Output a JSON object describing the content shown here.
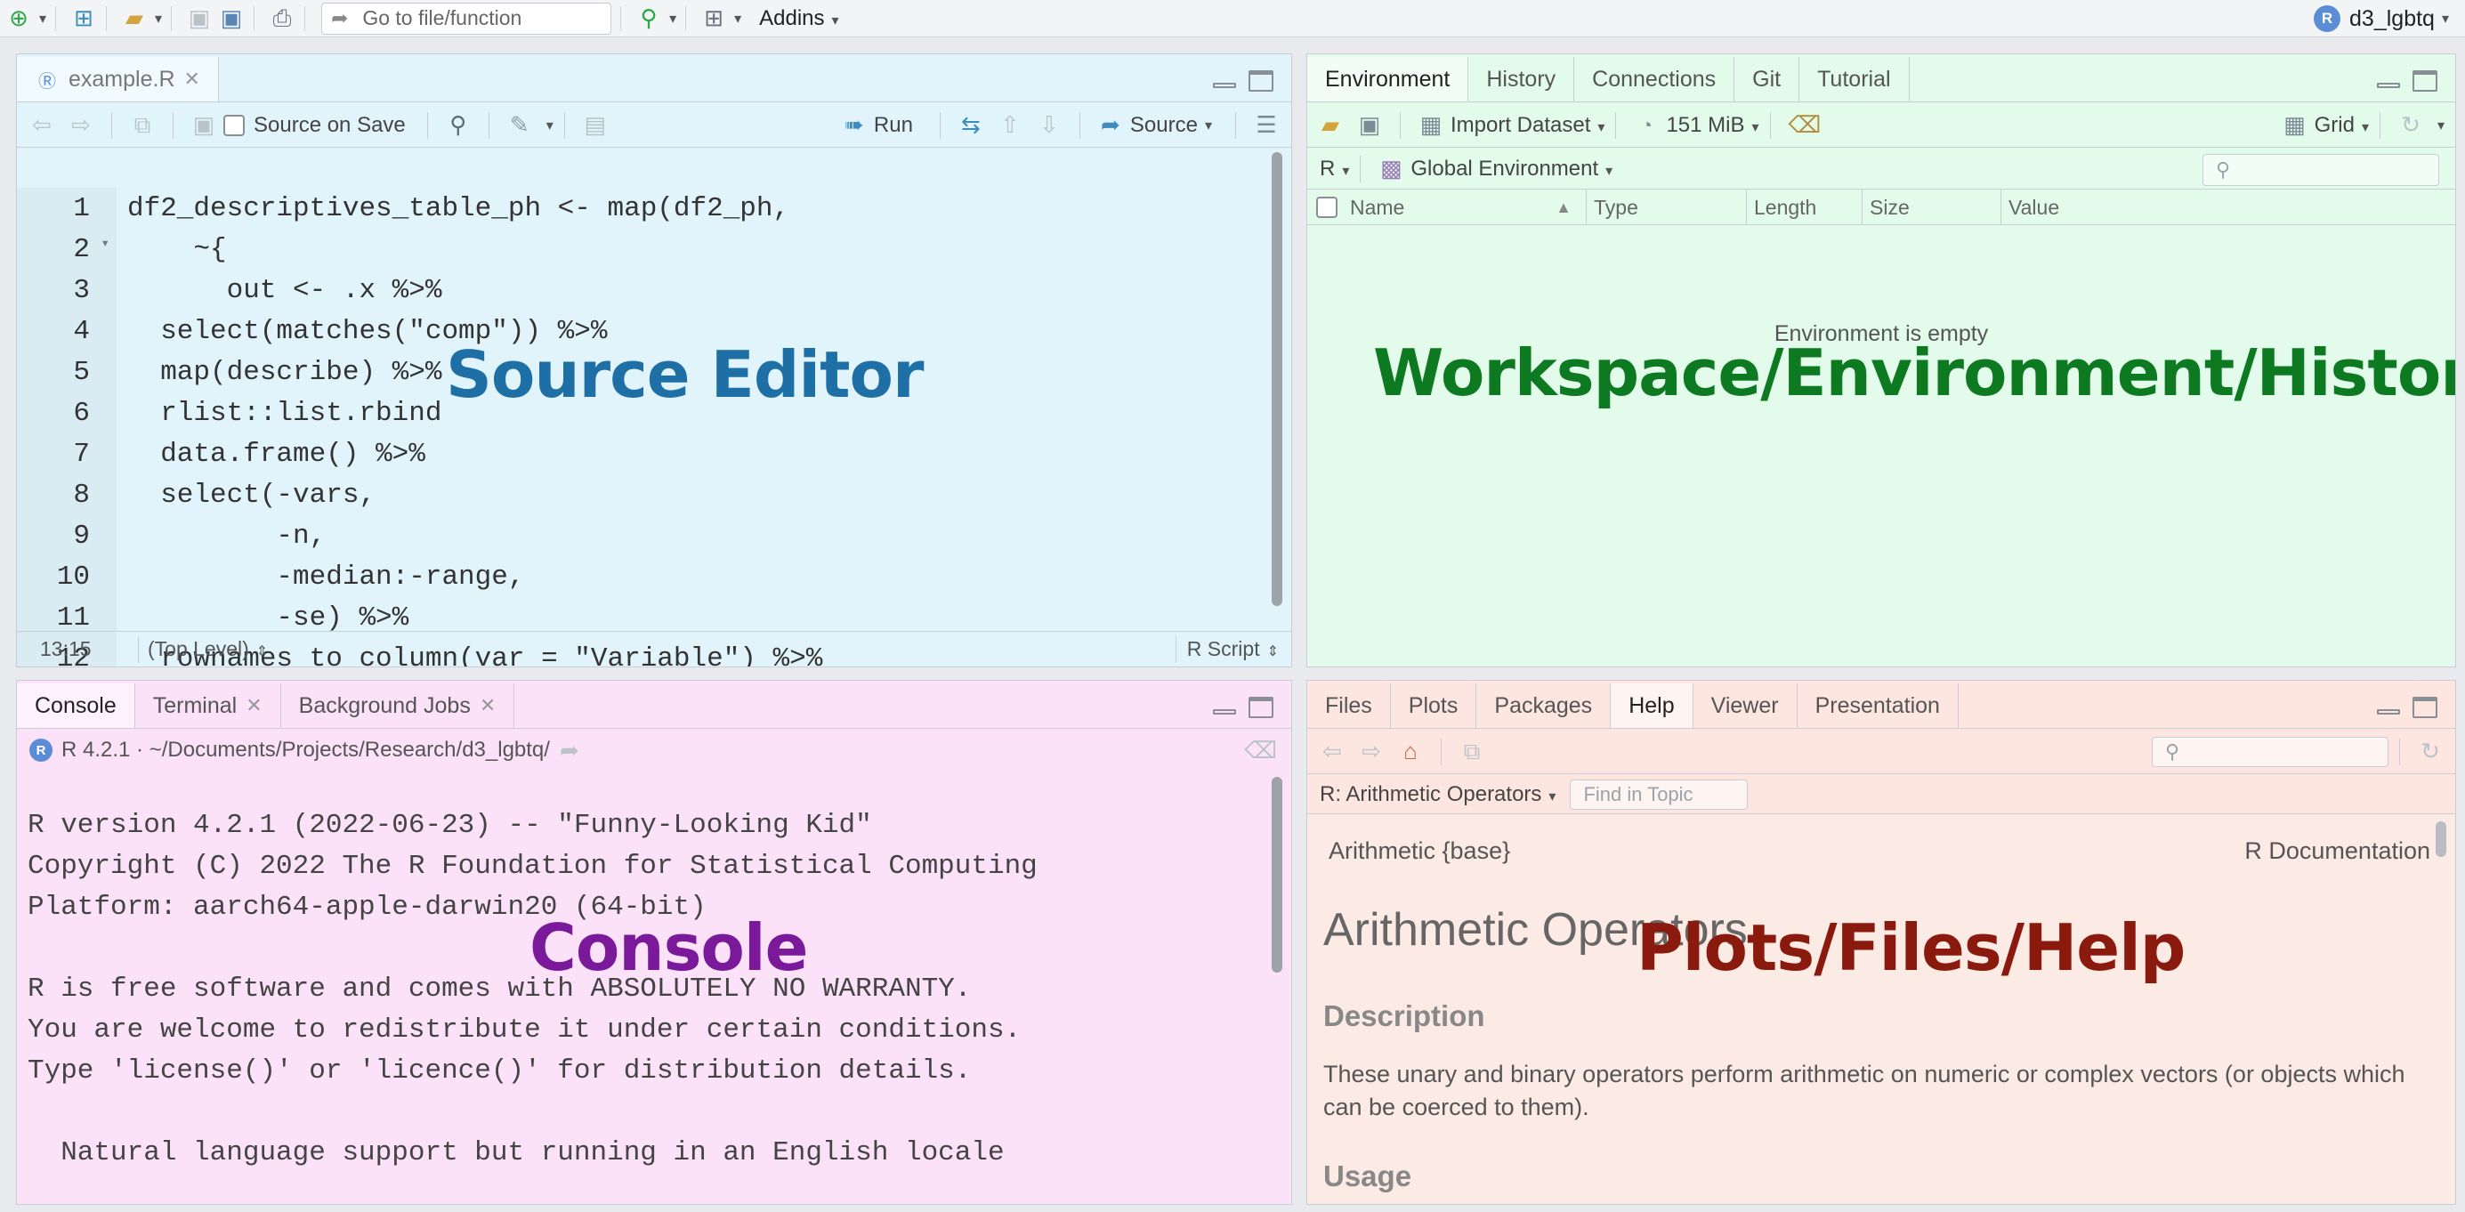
{
  "toolbar": {
    "goto_placeholder": "Go to file/function",
    "addins_label": "Addins",
    "project_name": "d3_lgbtq"
  },
  "source": {
    "file_tab": "example.R",
    "source_on_save": "Source on Save",
    "run_label": "Run",
    "source_label": "Source",
    "lines": [
      {
        "n": "1",
        "text": "df2_descriptives_table_ph <- map(df2_ph,",
        "fold": false
      },
      {
        "n": "2",
        "text": "    ~{",
        "fold": true
      },
      {
        "n": "3",
        "text": "      out <- .x %>%",
        "fold": false
      },
      {
        "n": "4",
        "text": "  select(matches(\"comp\")) %>%",
        "fold": false
      },
      {
        "n": "5",
        "text": "  map(describe) %>%",
        "fold": false
      },
      {
        "n": "6",
        "text": "  rlist::list.rbind",
        "fold": false
      },
      {
        "n": "7",
        "text": "  data.frame() %>%",
        "fold": false
      },
      {
        "n": "8",
        "text": "  select(-vars,",
        "fold": false
      },
      {
        "n": "9",
        "text": "         -n,",
        "fold": false
      },
      {
        "n": "10",
        "text": "         -median:-range,",
        "fold": false
      },
      {
        "n": "11",
        "text": "         -se) %>%",
        "fold": false
      },
      {
        "n": "12",
        "text": "  rownames_to_column(var = \"Variable\") %>%",
        "fold": false
      }
    ],
    "status_position": "13:15",
    "status_scope": "(Top Level)",
    "status_type": "R Script"
  },
  "environment": {
    "tabs": [
      "Environment",
      "History",
      "Connections",
      "Git",
      "Tutorial"
    ],
    "import_dataset": "Import Dataset",
    "memory": "151 MiB",
    "grid_label": "Grid",
    "lang": "R",
    "scope": "Global Environment",
    "columns": [
      "Name",
      "Type",
      "Length",
      "Size",
      "Value"
    ],
    "empty_message": "Environment is empty"
  },
  "console": {
    "tabs": [
      "Console",
      "Terminal",
      "Background Jobs"
    ],
    "r_version_path": "R 4.2.1 · ~/Documents/Projects/Research/d3_lgbtq/",
    "output": [
      "R version 4.2.1 (2022-06-23) -- \"Funny-Looking Kid\"",
      "Copyright (C) 2022 The R Foundation for Statistical Computing",
      "Platform: aarch64-apple-darwin20 (64-bit)",
      "",
      "R is free software and comes with ABSOLUTELY NO WARRANTY.",
      "You are welcome to redistribute it under certain conditions.",
      "Type 'license()' or 'licence()' for distribution details.",
      "",
      "  Natural language support but running in an English locale"
    ]
  },
  "help": {
    "tabs": [
      "Files",
      "Plots",
      "Packages",
      "Help",
      "Viewer",
      "Presentation"
    ],
    "topic": "R: Arithmetic Operators",
    "find_placeholder": "Find in Topic",
    "header_left": "Arithmetic {base}",
    "header_right": "R Documentation",
    "title": "Arithmetic Operators",
    "description_heading": "Description",
    "description_text": "These unary and binary operators perform arithmetic on numeric or complex vectors (or objects which can be coerced to them).",
    "usage_heading": "Usage"
  },
  "overlays": {
    "source": "Source Editor",
    "environment": "Workspace/Environment/History",
    "console": "Console",
    "help": "Plots/Files/Help"
  },
  "colors": {
    "source_bg": "#e1f4fb",
    "environment_bg": "#e2fbea",
    "console_bg": "#fbe2f9",
    "help_bg": "#fce6df",
    "overlay_source": "#1d6fa5",
    "overlay_environment": "#0d7a22",
    "overlay_console": "#7a1a9a",
    "overlay_help": "#8b1a0e"
  }
}
